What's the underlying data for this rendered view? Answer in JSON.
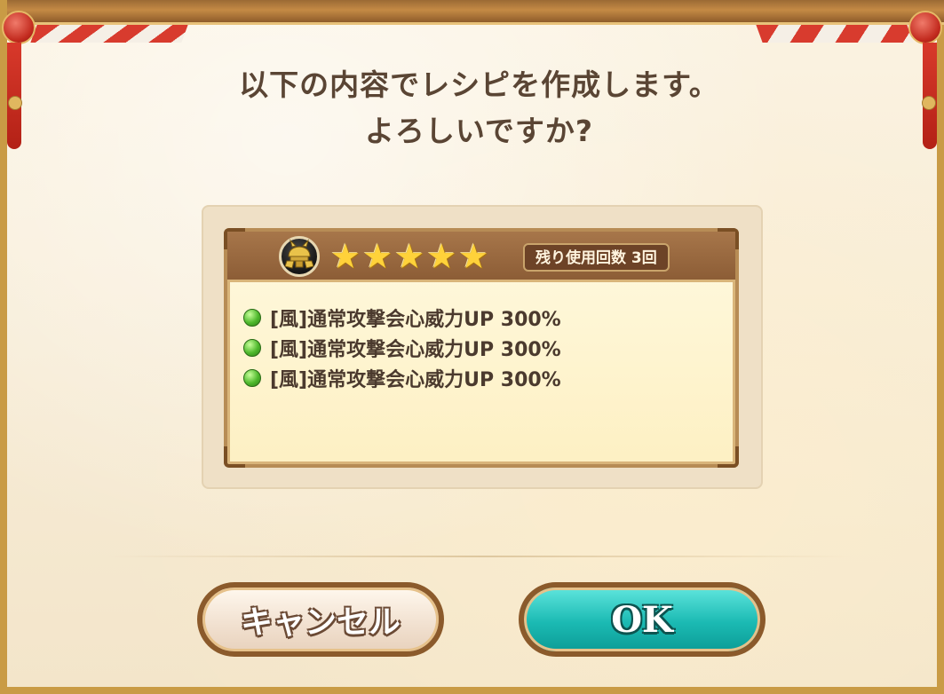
{
  "dialog": {
    "title_line1": "以下の内容でレシピを作成します。",
    "title_line2": "よろしいですか?"
  },
  "recipe": {
    "icon": "samurai-helmet-icon",
    "stars": [
      "★",
      "★",
      "★",
      "★",
      "★"
    ],
    "star_rating": 5,
    "uses_remaining_label": "残り使用回数 3回",
    "effects": [
      {
        "icon": "green-orb-icon",
        "text": "[風]通常攻撃会心威力UP 300%"
      },
      {
        "icon": "green-orb-icon",
        "text": "[風]通常攻撃会心威力UP 300%"
      },
      {
        "icon": "green-orb-icon",
        "text": "[風]通常攻撃会心威力UP 300%"
      }
    ]
  },
  "buttons": {
    "cancel_label": "キャンセル",
    "ok_label": "OK"
  },
  "colors": {
    "title_text": "#5a4534",
    "ok_button": "#1bbab3",
    "frame_gold": "#c99b45",
    "ribbon_red": "#d83b2e"
  }
}
